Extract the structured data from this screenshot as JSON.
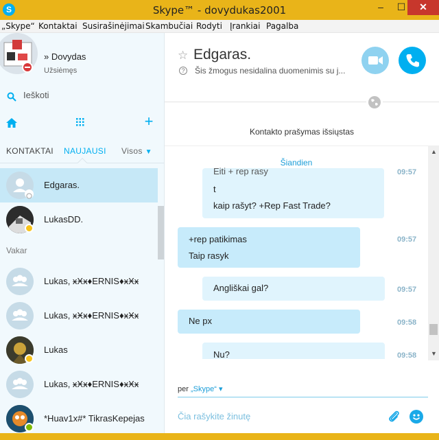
{
  "window": {
    "title": "Skype™ - dovydukas2001",
    "minimize": "–",
    "maximize": "☐",
    "close": "✕",
    "accent": "#e9b419"
  },
  "menu": [
    "„Skype“",
    "Kontaktai",
    "Susirašinėjimai",
    "Skambučiai",
    "Rodyti",
    "Įrankiai",
    "Pagalba"
  ],
  "profile": {
    "name": "» Dovydas",
    "status": "Užsiėmęs"
  },
  "search": {
    "label": "Ieškoti"
  },
  "tabs": {
    "contacts": "KONTAKTAI",
    "recent": "NAUJAUSI",
    "all": "Visos"
  },
  "contacts": [
    {
      "name": "Edgaras.",
      "status": "unknown",
      "avatar": "default-avatar"
    },
    {
      "name": "LukasDD.",
      "status": "away",
      "avatar": "photo"
    }
  ],
  "section_yesterday": "Vakar",
  "contacts_yesterday": [
    {
      "name": "Lukas, ӿӾӿ♦ERNIS♦ӿӾӿ",
      "avatar": "group-avatar"
    },
    {
      "name": "Lukas, ӿӾӿ♦ERNIS♦ӿӾӿ",
      "avatar": "group-avatar"
    },
    {
      "name": "Lukas",
      "status": "away",
      "avatar": "photo"
    },
    {
      "name": "Lukas, ӿӾӿ♦ERNIS♦ӿӾӿ",
      "avatar": "group-avatar"
    },
    {
      "name": "*Huav1x#* TikrasKepejas",
      "status": "online",
      "avatar": "photo"
    }
  ],
  "chat": {
    "title": "Edgaras.",
    "subtitle": "Šis žmogus nesidalina duomenimis su j...",
    "request_text": "Kontakto prašymas išsiųstas",
    "today": "Šiandien",
    "messages": [
      {
        "direction": "out",
        "lines": [
          "Eiti + rep rasy",
          "t",
          "kaip rašyt? +Rep Fast Trade?"
        ],
        "time": "09:57"
      },
      {
        "direction": "in",
        "lines": [
          "+rep patikimas",
          "Taip rasyk"
        ],
        "time": "09:57"
      },
      {
        "direction": "out",
        "lines": [
          "Angliškai gal?"
        ],
        "time": "09:57"
      },
      {
        "direction": "in",
        "lines": [
          "Ne px"
        ],
        "time": "09:58"
      },
      {
        "direction": "out",
        "lines": [
          "Nu?"
        ],
        "time": "09:58"
      }
    ],
    "via_prefix": "per",
    "via_service": "„Skype“",
    "compose_placeholder": "Čia rašykite žinutę"
  },
  "colors": {
    "skype_blue": "#00aff0",
    "incoming_bubble": "#c7ebfb",
    "outgoing_bubble": "#e0f4fd",
    "status_away": "#f8c31b",
    "status_online": "#7fba00"
  }
}
